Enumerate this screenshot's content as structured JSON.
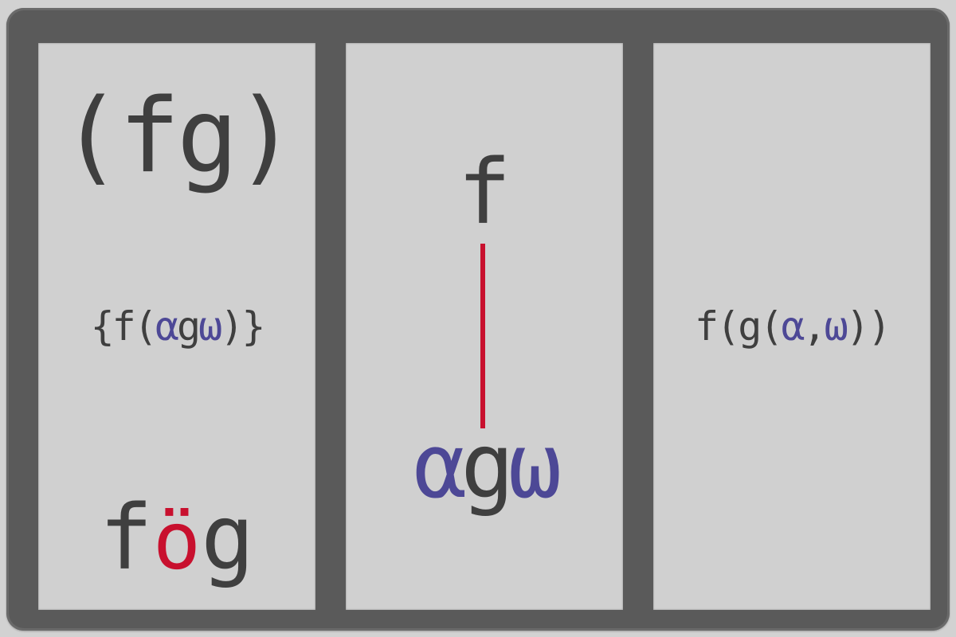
{
  "panels": {
    "left": {
      "train": {
        "open": "(",
        "f": "f",
        "g": "g",
        "close": ")"
      },
      "dfn": {
        "open_brace": "{",
        "f": "f",
        "open_paren": "(",
        "alpha": "α",
        "g": "g",
        "omega": "ω",
        "close_paren": ")",
        "close_brace": "}"
      },
      "atop": {
        "f": "f",
        "op": "ö",
        "g": "g"
      }
    },
    "middle": {
      "top": "f",
      "bottom": {
        "alpha": "α",
        "g": "g",
        "omega": "ω"
      }
    },
    "right": {
      "call": {
        "f": "f",
        "open1": "(",
        "g": "g",
        "open2": "(",
        "alpha": "α",
        "comma": ",",
        "omega": "ω",
        "close2": ")",
        "close1": ")"
      }
    }
  },
  "colors": {
    "frame": "#5a5a5a",
    "panel": "#d0d0d0",
    "text": "#3f3f3f",
    "argument": "#4d4896",
    "operator": "#c8102e"
  }
}
